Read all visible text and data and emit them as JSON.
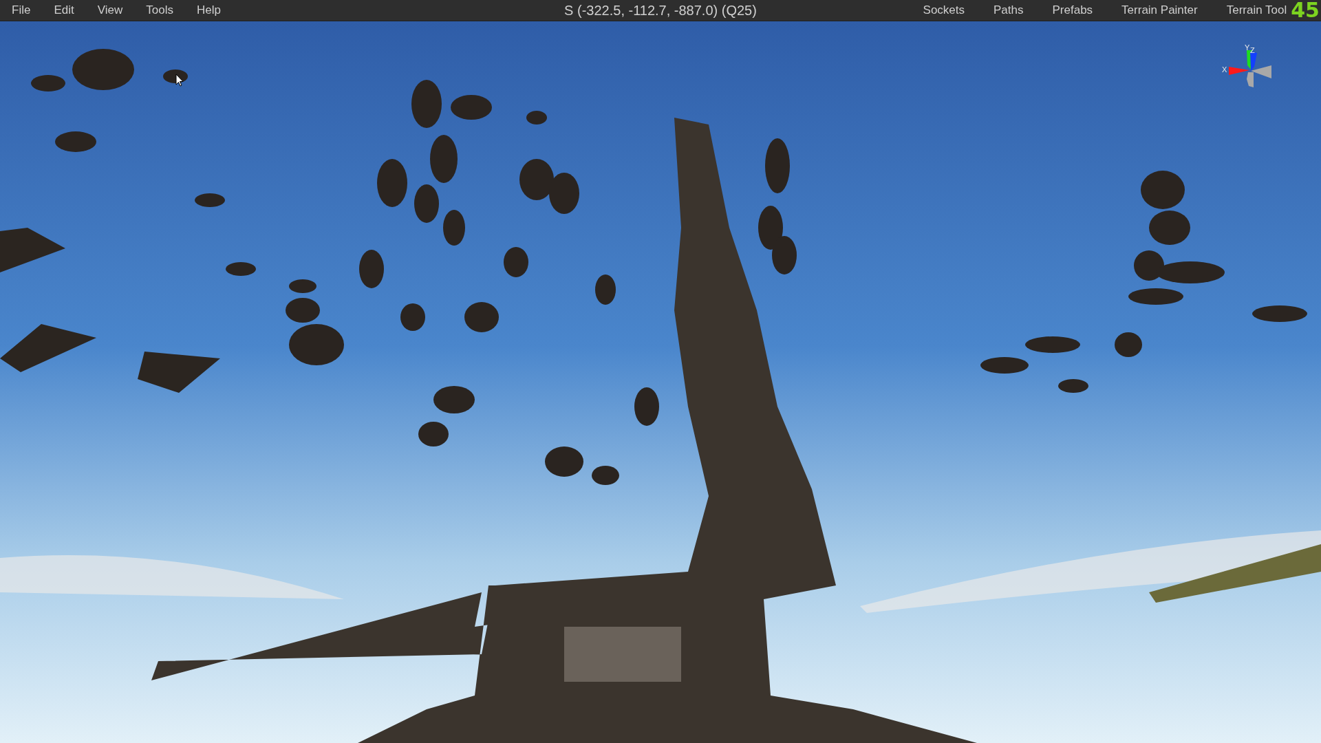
{
  "menu": [
    "File",
    "Edit",
    "View",
    "Tools",
    "Help"
  ],
  "camera_status": "S (-322.5, -112.7, -887.0) (Q25)",
  "panels": [
    "Sockets",
    "Paths",
    "Prefabs",
    "Terrain Painter",
    "Terrain Tool"
  ],
  "fps": "45",
  "gizmo": {
    "x_label": "X",
    "y_label": "Y",
    "z_label": "Z"
  }
}
